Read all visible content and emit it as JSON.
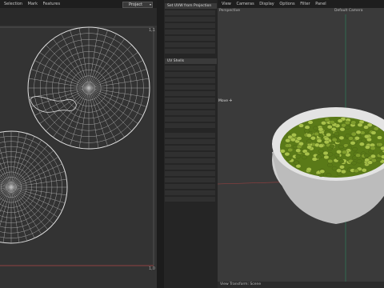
{
  "uv_editor": {
    "menu": [
      "Selection",
      "Mark",
      "Features"
    ],
    "project_dropdown": "Project",
    "corner_top_right": "1,1",
    "corner_bottom_right": "1,0"
  },
  "panel": {
    "sections": [
      {
        "title": "Set UVW from Projection",
        "rows": 7
      },
      {
        "title": "UV Shells",
        "rows": 10
      },
      {
        "title": "",
        "rows": 11
      }
    ]
  },
  "viewport": {
    "menu": [
      "View",
      "Cameras",
      "Display",
      "Options",
      "Filter",
      "Panel"
    ],
    "view_name": "Perspective",
    "camera_name": "Default Camera",
    "bottom_label": "View Transform: Scene",
    "marker_label": "Move"
  },
  "colors": {
    "bowl": "#d8d8d8",
    "peas_dark": "#5a7a18",
    "peas_light": "#a8c24a",
    "axis_red": "#a04040",
    "axis_green": "#2a8a60"
  },
  "icons": [
    "gear-icon",
    "eye-icon",
    "caret-icon"
  ]
}
